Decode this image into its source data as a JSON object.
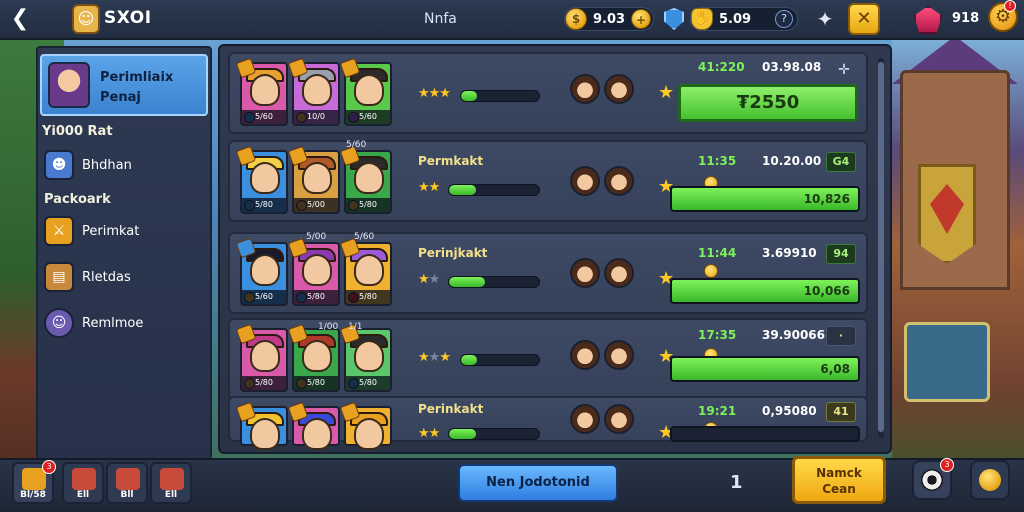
{
  "topbar": {
    "back_symbol": "❮",
    "title": "SXOI",
    "center_label": "Nnfa",
    "coins": "9.03",
    "shield_value": "5.09",
    "shield_info": "?",
    "close_symbol": "✕",
    "gems": "918"
  },
  "sidebar": {
    "active": {
      "line1": "Perimliaix",
      "line2": "Penaj"
    },
    "heading1": "Yi000 Rat",
    "heading2": "Packoark",
    "items": [
      {
        "label": "Bhdhan",
        "icon": "character-icon"
      },
      {
        "label": "Perimkat",
        "icon": "sword-icon"
      },
      {
        "label": "Rletdas",
        "icon": "chest-icon"
      },
      {
        "label": "Remlmoe",
        "icon": "portrait-icon"
      }
    ]
  },
  "rows": [
    {
      "title": "",
      "cards": [
        "5/60",
        "10/0",
        "5/60"
      ],
      "card_top_labels": [],
      "stars_on": 3,
      "stars_total": 3,
      "progress": 0.2,
      "stat_left": "41:220",
      "stat_right": "03.98.08",
      "action": "plus",
      "buy_label": "₮2550"
    },
    {
      "title": "Permkakt",
      "cards": [
        "5/80",
        "5/00",
        "5/80"
      ],
      "card_top_labels": [
        "",
        "",
        "5/60"
      ],
      "stars_on": 2,
      "stars_total": 2,
      "progress": 0.3,
      "stat_left": "11:35",
      "stat_right": "10.20.00",
      "bonus": "G4",
      "track_value": "10,826",
      "track_fill": 1.0
    },
    {
      "title": "Perinjkakt",
      "cards": [
        "5/60",
        "5/80",
        "5/80"
      ],
      "card_top_labels": [
        "",
        "5/00",
        "5/60"
      ],
      "stars_on": 1,
      "stars_total": 2,
      "progress": 0.4,
      "stat_left": "11:44",
      "stat_right": "3.69910",
      "bonus": "94",
      "track_value": "10,066",
      "track_fill": 1.0
    },
    {
      "title": "",
      "cards": [
        "5/80",
        "5/80",
        "5/80"
      ],
      "card_top_labels": [
        "",
        "1/00",
        "1/1"
      ],
      "stars_on": 2,
      "stars_total": 3,
      "progress": 0.2,
      "stat_left": "17:35",
      "stat_right": "39.90066",
      "bonus": "·",
      "track_value": "6,08",
      "track_fill": 1.0
    },
    {
      "title": "Perinkakt",
      "cards": [
        "",
        "",
        ""
      ],
      "card_top_labels": [],
      "stars_on": 2,
      "stars_total": 2,
      "progress": 0.3,
      "stat_left": "19:21",
      "stat_right": "0,95080",
      "bonus": "41",
      "track_value": "",
      "track_fill": 0.0
    }
  ],
  "bottombar": {
    "tiles": [
      {
        "label": "Bl/58",
        "badge": "3"
      },
      {
        "label": "Ell",
        "badge": ""
      },
      {
        "label": "Bll",
        "badge": ""
      },
      {
        "label": "Ell",
        "badge": ""
      }
    ],
    "main_button": "Nen Jodotonid",
    "page": "1",
    "confirm_line1": "Namck",
    "confirm_line2": "Cean",
    "right_badge": "3"
  },
  "colors": {
    "accent_green": "#44c030",
    "accent_blue": "#2f7ee0",
    "accent_gold": "#f0a810",
    "panel": "#30394f"
  }
}
